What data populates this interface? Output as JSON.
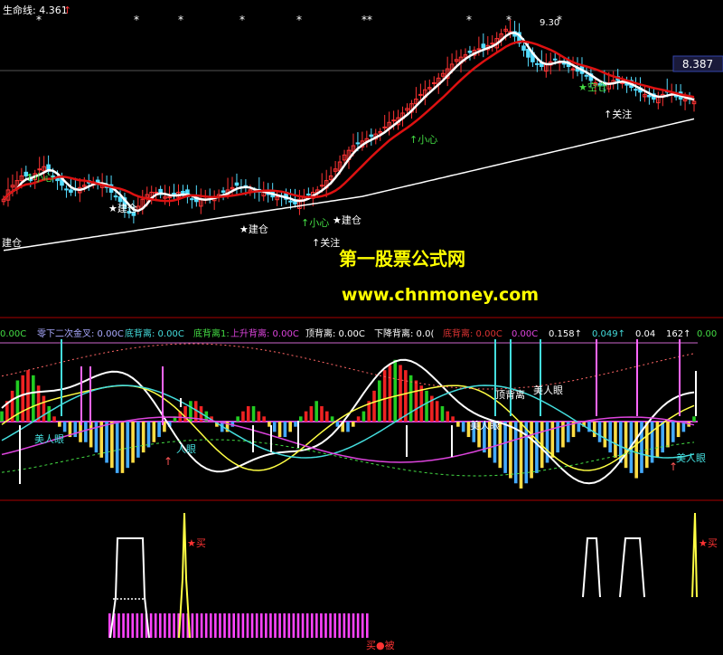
{
  "header": {
    "indicator_label": "生命线: 4.361",
    "up_arrow": "↑",
    "price_badge": "8.387",
    "peak_label": "9.30",
    "star_marks": [
      "*",
      "*",
      "*",
      "*",
      "*",
      "**",
      "*",
      "*",
      "*"
    ]
  },
  "watermark": {
    "name": "第一股票公式网",
    "url": "www.chnmoney.com"
  },
  "main_annotations": [
    {
      "text": "建仓",
      "color": "#ffffff"
    },
    {
      "text": "↑小心",
      "color": "#44dd44"
    },
    {
      "text": "★建仓",
      "color": "#ffffff"
    },
    {
      "text": "★建仓",
      "color": "#ffffff"
    },
    {
      "text": "↑关注",
      "color": "#ffffff"
    },
    {
      "text": "★建仓",
      "color": "#ffffff"
    },
    {
      "text": "↑小心",
      "color": "#44dd44"
    },
    {
      "text": "↑小心",
      "color": "#44dd44"
    },
    {
      "text": "★空仓",
      "color": "#44dd44"
    },
    {
      "text": "↑关注",
      "color": "#ffffff"
    }
  ],
  "macd_legend": [
    {
      "text": "0.00C",
      "color": "#44dd44"
    },
    {
      "text": "零下二次金叉: 0.00C",
      "color": "#aaaaff"
    },
    {
      "text": "底背离: 0.00C",
      "color": "#44dddd"
    },
    {
      "text": "底背离1:",
      "color": "#44dd44"
    },
    {
      "text": "上升背离: 0.00C",
      "color": "#dd44dd"
    },
    {
      "text": "顶背离: 0.00C",
      "color": "#ffffff"
    },
    {
      "text": "下降背离: 0.0(",
      "color": "#ffffff"
    },
    {
      "text": "底背离: 0.00C",
      "color": "#dd3333"
    },
    {
      "text": "0.00C",
      "color": "#dd44dd"
    },
    {
      "text": "0.158↑",
      "color": "#ffffff"
    },
    {
      "text": "0.049↑",
      "color": "#44dddd"
    },
    {
      "text": "0.04",
      "color": "#ffffff"
    },
    {
      "text": "162↑",
      "color": "#ffffff"
    },
    {
      "text": "0.00",
      "color": "#44dd44"
    }
  ],
  "macd_annotations": [
    {
      "text": "美人眼",
      "color": "#44dddd"
    },
    {
      "text": "美人眼",
      "color": "#ffffff"
    },
    {
      "text": "顶背离",
      "color": "#ffffff"
    },
    {
      "text": "人眼",
      "color": "#44dddd"
    },
    {
      "text": "美人眼",
      "color": "#44dddd"
    },
    {
      "text": "美人眼",
      "color": "#ffffff"
    }
  ],
  "bottom_annotations": [
    {
      "text": "★买",
      "color": "#ff3333"
    },
    {
      "text": "★买",
      "color": "#ff3333"
    },
    {
      "text": "买●被",
      "color": "#ff3333"
    }
  ],
  "colors": {
    "background": "#000000",
    "candle_up": "#ff3333",
    "candle_down": "#55ddff",
    "ma_fast": "#ffffff",
    "ma_mid": "#dd1111",
    "ma_slow": "#ffffff",
    "macd_pos": "#ee2222",
    "macd_neg": "#44aaff",
    "macd_yellow": "#ffdd44",
    "macd_green": "#22cc22",
    "magenta": "#ff44ff",
    "divider": "#aa0000"
  },
  "chart_data": [
    {
      "type": "candlestick",
      "panel": "price",
      "x": [
        0,
        1,
        2,
        3,
        4,
        5,
        6,
        7,
        8,
        9,
        10,
        11,
        12,
        13,
        14,
        15,
        16,
        17,
        18,
        19,
        20,
        21,
        22,
        23,
        24,
        25,
        26,
        27,
        28,
        29,
        30,
        31,
        32,
        33,
        34,
        35,
        36,
        37,
        38,
        39,
        40,
        41,
        42,
        43,
        44,
        45,
        46,
        47,
        48,
        49,
        50,
        51,
        52,
        53,
        54,
        55,
        56,
        57,
        58,
        59,
        60,
        61,
        62,
        63,
        64,
        65,
        66,
        67,
        68,
        69,
        70,
        71,
        72,
        73,
        74,
        75,
        76,
        77,
        78,
        79,
        80,
        81,
        82,
        83,
        84,
        85,
        86,
        87,
        88,
        89,
        90,
        91,
        92,
        93,
        94,
        95,
        96,
        97,
        98,
        99,
        100,
        101,
        102,
        103,
        104,
        105,
        106,
        107,
        108,
        109,
        110,
        111,
        112,
        113,
        114,
        115,
        116,
        117,
        118,
        119,
        120,
        121,
        122,
        123,
        124,
        125,
        126,
        127,
        128,
        129,
        130,
        131,
        132,
        133,
        134,
        135,
        136,
        137,
        138,
        139,
        140,
        141,
        142,
        143,
        144,
        145,
        146,
        147,
        148,
        149,
        150,
        151,
        152,
        153,
        154
      ],
      "close": [
        5.55,
        5.75,
        5.85,
        5.95,
        6.05,
        6.05,
        5.95,
        6.1,
        6.2,
        6.25,
        6.15,
        6.05,
        5.95,
        5.85,
        5.75,
        5.7,
        5.75,
        5.8,
        5.85,
        5.9,
        5.92,
        5.9,
        5.85,
        5.8,
        5.7,
        5.6,
        5.5,
        5.35,
        5.25,
        5.2,
        5.4,
        5.55,
        5.65,
        5.7,
        5.7,
        5.65,
        5.6,
        5.6,
        5.65,
        5.7,
        5.65,
        5.6,
        5.55,
        5.5,
        5.55,
        5.55,
        5.6,
        5.6,
        5.65,
        5.7,
        5.75,
        5.8,
        5.85,
        5.8,
        5.8,
        5.75,
        5.7,
        5.7,
        5.7,
        5.65,
        5.6,
        5.6,
        5.6,
        5.55,
        5.5,
        5.45,
        5.55,
        5.6,
        5.65,
        5.7,
        5.75,
        5.85,
        5.95,
        6.05,
        6.2,
        6.35,
        6.5,
        6.6,
        6.7,
        6.75,
        6.8,
        6.85,
        6.9,
        6.95,
        7.0,
        7.1,
        7.2,
        7.25,
        7.3,
        7.4,
        7.5,
        7.6,
        7.7,
        7.8,
        7.9,
        7.95,
        8.05,
        8.15,
        8.25,
        8.35,
        8.45,
        8.55,
        8.6,
        8.65,
        8.7,
        8.75,
        8.78,
        8.8,
        8.85,
        8.9,
        9.0,
        9.1,
        9.2,
        9.15,
        9.05,
        8.9,
        8.75,
        8.6,
        8.5,
        8.45,
        8.4,
        8.45,
        8.5,
        8.55,
        8.5,
        8.45,
        8.4,
        8.35,
        8.3,
        8.25,
        8.2,
        8.1,
        8.05,
        8.0,
        8.0,
        8.05,
        8.1,
        8.1,
        8.05,
        8.0,
        7.95,
        7.9,
        7.85,
        7.8,
        7.75,
        7.7,
        7.75,
        7.8,
        7.85,
        7.8,
        7.75,
        7.7,
        7.7,
        7.7,
        7.65
      ],
      "series": [
        {
          "name": "",
          "role": "ma_fast"
        },
        {
          "name": "",
          "role": "ma_mid"
        },
        {
          "name": "",
          "role": "ma_slow"
        }
      ],
      "peak_value": 9.3,
      "ylim": [
        4.0,
        9.4
      ]
    },
    {
      "type": "bar",
      "panel": "macd",
      "values": [
        0.02,
        0.04,
        0.06,
        0.08,
        0.09,
        0.1,
        0.09,
        0.07,
        0.05,
        0.03,
        0.01,
        -0.01,
        -0.02,
        -0.03,
        -0.03,
        -0.04,
        -0.04,
        -0.05,
        -0.06,
        -0.07,
        -0.08,
        -0.09,
        -0.1,
        -0.1,
        -0.09,
        -0.08,
        -0.07,
        -0.06,
        -0.05,
        -0.04,
        -0.03,
        -0.02,
        -0.01,
        0.01,
        0.02,
        0.03,
        0.04,
        0.04,
        0.03,
        0.02,
        0.01,
        -0.01,
        -0.02,
        -0.02,
        -0.01,
        0.01,
        0.02,
        0.03,
        0.03,
        0.02,
        0.01,
        -0.01,
        -0.02,
        -0.03,
        -0.03,
        -0.02,
        -0.01,
        0.01,
        0.02,
        0.03,
        0.04,
        0.03,
        0.02,
        0.01,
        -0.01,
        -0.02,
        -0.02,
        -0.01,
        0.01,
        0.02,
        0.04,
        0.06,
        0.08,
        0.1,
        0.11,
        0.12,
        0.11,
        0.1,
        0.09,
        0.08,
        0.07,
        0.06,
        0.05,
        0.04,
        0.03,
        0.02,
        0.01,
        -0.01,
        -0.02,
        -0.03,
        -0.04,
        -0.05,
        -0.06,
        -0.07,
        -0.08,
        -0.09,
        -0.1,
        -0.11,
        -0.12,
        -0.13,
        -0.12,
        -0.11,
        -0.1,
        -0.09,
        -0.08,
        -0.07,
        -0.06,
        -0.05,
        -0.04,
        -0.03,
        -0.02,
        -0.01,
        -0.02,
        -0.03,
        -0.04,
        -0.05,
        -0.06,
        -0.07,
        -0.08,
        -0.09,
        -0.1,
        -0.11,
        -0.1,
        -0.09,
        -0.08,
        -0.07,
        -0.06,
        -0.05,
        -0.04,
        -0.03,
        -0.02,
        -0.01,
        0.01
      ],
      "ylim": [
        -0.16,
        0.16
      ]
    },
    {
      "type": "bar",
      "panel": "signal",
      "values": [
        0,
        0,
        0,
        0,
        0,
        0,
        0,
        0,
        0,
        0,
        0,
        0,
        0,
        0,
        0,
        0,
        0,
        0,
        0,
        0,
        0,
        0,
        0,
        0,
        1,
        1,
        1,
        1,
        1,
        1,
        1,
        1,
        1,
        1,
        1,
        1,
        1,
        1,
        1,
        1,
        1,
        1,
        1,
        1,
        1,
        1,
        1,
        1,
        1,
        1,
        1,
        1,
        1,
        1,
        1,
        1,
        1,
        1,
        1,
        1,
        1,
        1,
        1,
        1,
        1,
        1,
        1,
        1,
        1,
        1,
        1,
        1,
        1,
        1,
        1,
        1,
        1,
        1,
        1,
        1,
        1,
        0,
        0,
        0,
        0,
        0,
        0,
        0,
        0,
        0,
        0,
        0,
        0,
        0,
        0,
        0,
        0,
        0,
        0,
        0,
        0,
        0,
        0,
        0,
        0,
        0,
        0,
        0,
        0,
        0,
        0,
        0,
        0,
        0,
        0,
        0,
        0,
        0,
        0,
        0,
        0,
        0,
        0,
        0,
        0,
        0,
        0,
        0,
        0,
        0,
        0,
        0,
        0,
        0,
        0,
        0,
        0,
        0,
        0,
        0,
        0,
        0,
        0,
        0,
        0,
        0,
        0,
        0,
        0,
        0,
        0,
        0,
        0,
        0,
        0,
        0
      ],
      "ylim": [
        0,
        1
      ]
    }
  ]
}
